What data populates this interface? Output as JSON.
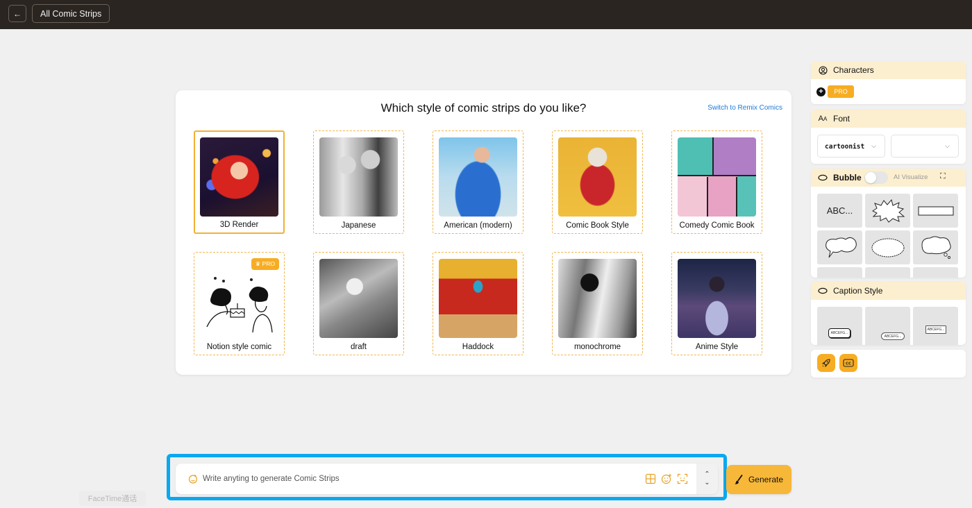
{
  "topbar": {
    "back_icon": "arrow-left-icon",
    "back_glyph": "←",
    "breadcrumb": "All Comic Strips"
  },
  "style_picker": {
    "title": "Which style of comic strips do you like?",
    "remix_link": "Switch to Remix Comics",
    "selected": "3D Render",
    "styles": [
      {
        "label": "3D Render",
        "selected": true,
        "pro": false
      },
      {
        "label": "Japanese",
        "selected": false,
        "pro": false
      },
      {
        "label": "American (modern)",
        "selected": false,
        "pro": false
      },
      {
        "label": "Comic Book Style",
        "selected": false,
        "pro": false
      },
      {
        "label": "Comedy Comic Book",
        "selected": false,
        "pro": false
      },
      {
        "label": "Notion style comic",
        "selected": false,
        "pro": true
      },
      {
        "label": "draft",
        "selected": false,
        "pro": false
      },
      {
        "label": "Haddock",
        "selected": false,
        "pro": false
      },
      {
        "label": "monochrome",
        "selected": false,
        "pro": false
      },
      {
        "label": "Anime Style",
        "selected": false,
        "pro": false
      }
    ],
    "pro_badge": "♛ PRO"
  },
  "sidebar": {
    "characters": {
      "title": "Characters",
      "add_glyph": "+",
      "pro_label": "PRO"
    },
    "font": {
      "title": "Font",
      "font_value": "cartoonist",
      "size_value": "",
      "chevron": "⌵"
    },
    "bubble": {
      "title": "Bubble",
      "ai_visualize_label": "AI Visualize",
      "ai_visualize_on": false,
      "expand_glyph": "⛶",
      "text_bubble_label": "ABC...",
      "options": [
        "text",
        "explosion",
        "rectangle",
        "speech-cloud",
        "spiky-oval",
        "thought-cloud"
      ]
    },
    "caption": {
      "title": "Caption Style",
      "samples": [
        "ABCEFG...",
        "ABCEFG...",
        "ABCEFG..."
      ]
    },
    "tools": [
      "rocket-icon",
      "closed-caption-icon"
    ],
    "cc_label": "CC"
  },
  "composer": {
    "placeholder": "Write anyting to generate Comic Strips",
    "value": "",
    "step_up": "⌃",
    "step_down": "⌄",
    "generate_label": "Generate"
  },
  "overlay": {
    "facetime_label": "FaceTime通话"
  },
  "colors": {
    "accent": "#f7ad23",
    "highlight_outline": "#0aa8f0",
    "link": "#1e7ad8",
    "topbar": "#2a2520",
    "panel_header": "#fcefcf"
  }
}
